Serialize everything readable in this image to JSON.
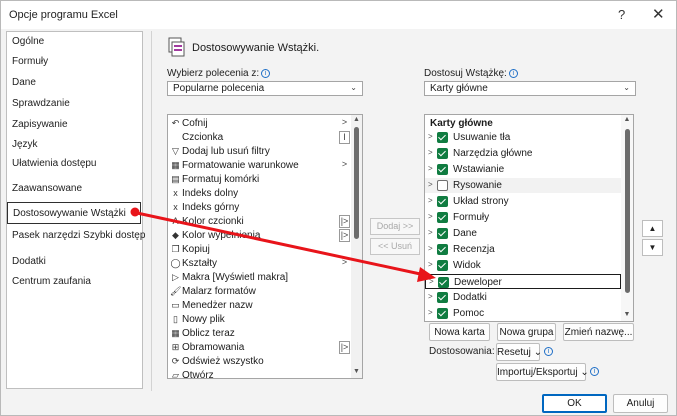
{
  "window": {
    "title": "Opcje programu Excel",
    "help": "?",
    "close": "✕"
  },
  "nav": {
    "items": [
      "Ogólne",
      "Formuły",
      "Dane",
      "Sprawdzanie",
      "Zapisywanie",
      "Język",
      "Ułatwienia dostępu",
      "Zaawansowane",
      "Dostosowywanie Wstążki",
      "Pasek narzędzi Szybki dostęp",
      "Dodatki",
      "Centrum zaufania"
    ],
    "selected": "Dostosowywanie Wstążki"
  },
  "main": {
    "title": "Dostosowywanie Wstążki.",
    "choose_label": "Wybierz polecenia z:",
    "choose_value": "Popularne polecenia",
    "customize_label": "Dostosuj Wstążkę:",
    "customize_value": "Karty główne"
  },
  "commands": [
    {
      "label": "Cofnij",
      "icon": "undo-icon",
      "glyph": "↶",
      "sub": ">"
    },
    {
      "label": "Czcionka",
      "icon": "font-icon",
      "glyph": "",
      "sub": "I"
    },
    {
      "label": "Dodaj lub usuń filtry",
      "icon": "filter-icon",
      "glyph": "▽",
      "sub": ""
    },
    {
      "label": "Formatowanie warunkowe",
      "icon": "conditional-format-icon",
      "glyph": "▦",
      "sub": ">"
    },
    {
      "label": "Formatuj komórki",
      "icon": "format-cells-icon",
      "glyph": "▤",
      "sub": ""
    },
    {
      "label": "Indeks dolny",
      "icon": "subscript-icon",
      "glyph": "x",
      "sub": ""
    },
    {
      "label": "Indeks górny",
      "icon": "superscript-icon",
      "glyph": "x",
      "sub": ""
    },
    {
      "label": "Kolor czcionki",
      "icon": "font-color-icon",
      "glyph": "A",
      "sub": "|>"
    },
    {
      "label": "Kolor wypełnienia",
      "icon": "fill-color-icon",
      "glyph": "◆",
      "sub": "|>"
    },
    {
      "label": "Kopiuj",
      "icon": "copy-icon",
      "glyph": "❐",
      "sub": ""
    },
    {
      "label": "Kształty",
      "icon": "shapes-icon",
      "glyph": "◯",
      "sub": ">"
    },
    {
      "label": "Makra [Wyświetl makra]",
      "icon": "macro-icon",
      "glyph": "▷",
      "sub": ""
    },
    {
      "label": "Malarz formatów",
      "icon": "format-painter-icon",
      "glyph": "🖌",
      "sub": ""
    },
    {
      "label": "Menedżer nazw",
      "icon": "name-manager-icon",
      "glyph": "▭",
      "sub": ""
    },
    {
      "label": "Nowy plik",
      "icon": "new-file-icon",
      "glyph": "▯",
      "sub": ""
    },
    {
      "label": "Oblicz teraz",
      "icon": "calculate-icon",
      "glyph": "▦",
      "sub": ""
    },
    {
      "label": "Obramowania",
      "icon": "borders-icon",
      "glyph": "⊞",
      "sub": "|>"
    },
    {
      "label": "Odśwież wszystko",
      "icon": "refresh-icon",
      "glyph": "⟳",
      "sub": ""
    },
    {
      "label": "Otwórz",
      "icon": "open-icon",
      "glyph": "▱",
      "sub": ""
    }
  ],
  "middle": {
    "add": "Dodaj >>",
    "remove": "<< Usuń"
  },
  "tabs": {
    "header": "Karty główne",
    "items": [
      {
        "label": "Usuwanie tła",
        "checked": true
      },
      {
        "label": "Narzędzia główne",
        "checked": true
      },
      {
        "label": "Wstawianie",
        "checked": true
      },
      {
        "label": "Rysowanie",
        "checked": false
      },
      {
        "label": "Układ strony",
        "checked": true
      },
      {
        "label": "Formuły",
        "checked": true
      },
      {
        "label": "Dane",
        "checked": true
      },
      {
        "label": "Recenzja",
        "checked": true
      },
      {
        "label": "Widok",
        "checked": true
      },
      {
        "label": "Deweloper",
        "checked": true
      },
      {
        "label": "Dodatki",
        "checked": true
      },
      {
        "label": "Pomoc",
        "checked": true
      }
    ],
    "highlighted": "Deweloper"
  },
  "tab_buttons": {
    "new_tab": "Nowa karta",
    "new_group": "Nowa grupa",
    "rename": "Zmień nazwę..."
  },
  "customizations": {
    "label": "Dostosowania:",
    "reset": "Resetuj",
    "import_export": "Importuj/Eksportuj"
  },
  "footer": {
    "ok": "OK",
    "cancel": "Anuluj"
  },
  "colors": {
    "accent": "#0067c0",
    "check": "#107c41",
    "annotation_arrow": "#e8141a"
  }
}
